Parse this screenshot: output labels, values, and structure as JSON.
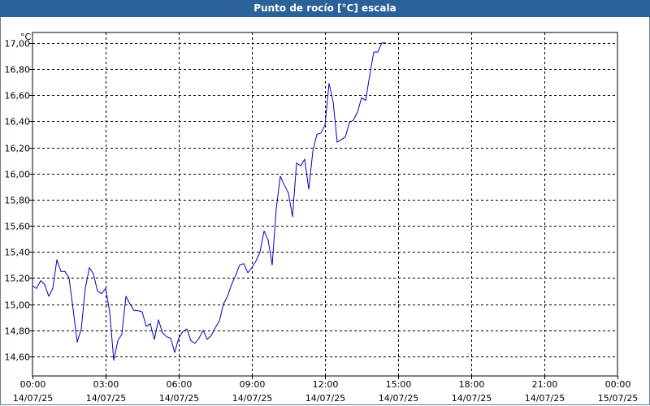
{
  "title": "Punto de rocío [°C] escala",
  "chart_data": {
    "type": "line",
    "title": "Punto de rocío [°C] escala",
    "ylabel": "°C",
    "xlabel": "",
    "ylim": [
      14.45,
      17.08
    ],
    "xlim_hours": [
      0,
      24
    ],
    "grid": true,
    "line_color": "#0000bb",
    "y_ticks": [
      "14,60",
      "14,80",
      "15,00",
      "15,20",
      "15,40",
      "15,60",
      "15,80",
      "16,00",
      "16,20",
      "16,40",
      "16,60",
      "16,80",
      "17,00"
    ],
    "x_ticks": [
      {
        "time": "00:00",
        "date": "14/07/25"
      },
      {
        "time": "03:00",
        "date": "14/07/25"
      },
      {
        "time": "06:00",
        "date": "14/07/25"
      },
      {
        "time": "09:00",
        "date": "14/07/25"
      },
      {
        "time": "12:00",
        "date": "14/07/25"
      },
      {
        "time": "15:00",
        "date": "14/07/25"
      },
      {
        "time": "18:00",
        "date": "14/07/25"
      },
      {
        "time": "21:00",
        "date": "14/07/25"
      },
      {
        "time": "00:00",
        "date": "15/07/25"
      }
    ],
    "series": [
      {
        "x": [
          "14/07/25 00:00",
          "14/07/25 00:10",
          "14/07/25 00:20",
          "14/07/25 00:30",
          "14/07/25 00:40",
          "14/07/25 00:50",
          "14/07/25 01:00",
          "14/07/25 01:10",
          "14/07/25 01:20",
          "14/07/25 01:30",
          "14/07/25 01:40",
          "14/07/25 01:50",
          "14/07/25 02:00",
          "14/07/25 02:10",
          "14/07/25 02:20",
          "14/07/25 02:30",
          "14/07/25 02:40",
          "14/07/25 02:50",
          "14/07/25 03:00",
          "14/07/25 03:10",
          "14/07/25 03:20",
          "14/07/25 03:30",
          "14/07/25 03:40",
          "14/07/25 03:50",
          "14/07/25 04:00",
          "14/07/25 04:10",
          "14/07/25 04:20",
          "14/07/25 04:30",
          "14/07/25 04:40",
          "14/07/25 04:50",
          "14/07/25 05:00",
          "14/07/25 05:10",
          "14/07/25 05:20",
          "14/07/25 05:30",
          "14/07/25 05:40",
          "14/07/25 05:50",
          "14/07/25 06:00",
          "14/07/25 06:10",
          "14/07/25 06:20",
          "14/07/25 06:30",
          "14/07/25 06:40",
          "14/07/25 06:50",
          "14/07/25 07:00",
          "14/07/25 07:10",
          "14/07/25 07:20",
          "14/07/25 07:30",
          "14/07/25 07:40",
          "14/07/25 07:50",
          "14/07/25 08:00",
          "14/07/25 08:10",
          "14/07/25 08:20",
          "14/07/25 08:30",
          "14/07/25 08:40",
          "14/07/25 08:50",
          "14/07/25 09:00",
          "14/07/25 09:10",
          "14/07/25 09:20",
          "14/07/25 09:30",
          "14/07/25 09:40",
          "14/07/25 09:50",
          "14/07/25 10:00",
          "14/07/25 10:10",
          "14/07/25 10:20",
          "14/07/25 10:30",
          "14/07/25 10:40",
          "14/07/25 10:50",
          "14/07/25 11:00",
          "14/07/25 11:10",
          "14/07/25 11:20",
          "14/07/25 11:30",
          "14/07/25 11:40",
          "14/07/25 11:50",
          "14/07/25 12:00",
          "14/07/25 12:10",
          "14/07/25 12:20",
          "14/07/25 12:30",
          "14/07/25 12:40",
          "14/07/25 12:50",
          "14/07/25 13:00",
          "14/07/25 13:10",
          "14/07/25 13:20",
          "14/07/25 13:30",
          "14/07/25 13:40",
          "14/07/25 13:50",
          "14/07/25 14:00",
          "14/07/25 14:10",
          "14/07/25 14:20",
          "14/07/25 14:30"
        ],
        "values": [
          15.14,
          15.12,
          15.18,
          15.15,
          15.06,
          15.12,
          15.34,
          15.25,
          15.25,
          15.2,
          14.96,
          14.71,
          14.81,
          15.12,
          15.28,
          15.23,
          15.1,
          15.08,
          15.12,
          14.94,
          14.57,
          14.72,
          14.77,
          15.06,
          15.0,
          14.95,
          14.95,
          14.94,
          14.83,
          14.85,
          14.73,
          14.88,
          14.78,
          14.75,
          14.74,
          14.63,
          14.74,
          14.79,
          14.81,
          14.72,
          14.7,
          14.74,
          14.8,
          14.73,
          14.76,
          14.82,
          14.87,
          15.0,
          15.06,
          15.15,
          15.22,
          15.3,
          15.31,
          15.24,
          15.28,
          15.33,
          15.4,
          15.56,
          15.49,
          15.3,
          15.73,
          15.98,
          15.91,
          15.85,
          15.67,
          16.08,
          16.06,
          16.11,
          15.88,
          16.17,
          16.3,
          16.31,
          16.37,
          16.69,
          16.55,
          16.24,
          16.26,
          16.28,
          16.39,
          16.41,
          16.47,
          16.58,
          16.56,
          16.75,
          16.93,
          16.93,
          17.0,
          17.0
        ]
      }
    ]
  }
}
